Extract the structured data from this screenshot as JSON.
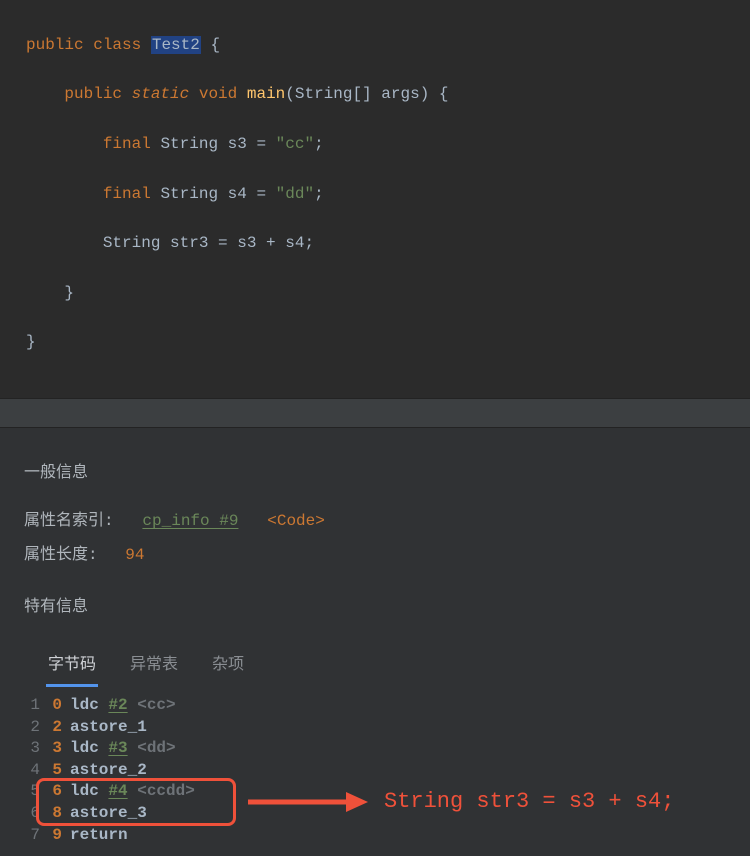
{
  "code": {
    "l1_public": "public",
    "l1_class": "class",
    "l1_name": "Test2",
    "l1_brace": " {",
    "l2_public": "public",
    "l2_static": "static",
    "l2_void": "void",
    "l2_main": "main",
    "l2_sig": "(String[] args) {",
    "l3_final": "final",
    "l3_type": "String",
    "l3_var": "s3",
    "l3_eq": " = ",
    "l3_str": "\"cc\"",
    "l3_semi": ";",
    "l4_final": "final",
    "l4_type": "String",
    "l4_var": "s4",
    "l4_eq": " = ",
    "l4_str": "\"dd\"",
    "l4_semi": ";",
    "l5_type": "String",
    "l5_var": "str3",
    "l5_eq": " = ",
    "l5_s3": "s3",
    "l5_plus": " + ",
    "l5_s4": "s4",
    "l5_semi": ";",
    "l6_brace": "}",
    "l7_brace": "}"
  },
  "info": {
    "sec1_title": "一般信息",
    "attr_idx_label": "属性名索引:",
    "cp_link": "cp_info #9",
    "code_tag": "<Code>",
    "attr_len_label": "属性长度:",
    "attr_len_val": "94",
    "sec2_title": "特有信息"
  },
  "tabs": {
    "t1": "字节码",
    "t2": "异常表",
    "t3": "杂项"
  },
  "bytecode": [
    {
      "ln": "1",
      "off": "0",
      "op": "ldc",
      "ref": "#2",
      "comment": " <cc>"
    },
    {
      "ln": "2",
      "off": "2",
      "op": "astore_1",
      "ref": "",
      "comment": ""
    },
    {
      "ln": "3",
      "off": "3",
      "op": "ldc",
      "ref": "#3",
      "comment": " <dd>"
    },
    {
      "ln": "4",
      "off": "5",
      "op": "astore_2",
      "ref": "",
      "comment": ""
    },
    {
      "ln": "5",
      "off": "6",
      "op": "ldc",
      "ref": "#4",
      "comment": " <ccdd>"
    },
    {
      "ln": "6",
      "off": "8",
      "op": "astore_3",
      "ref": "",
      "comment": ""
    },
    {
      "ln": "7",
      "off": "9",
      "op": "return",
      "ref": "",
      "comment": ""
    }
  ],
  "callout": "String str3 = s3 + s4;"
}
